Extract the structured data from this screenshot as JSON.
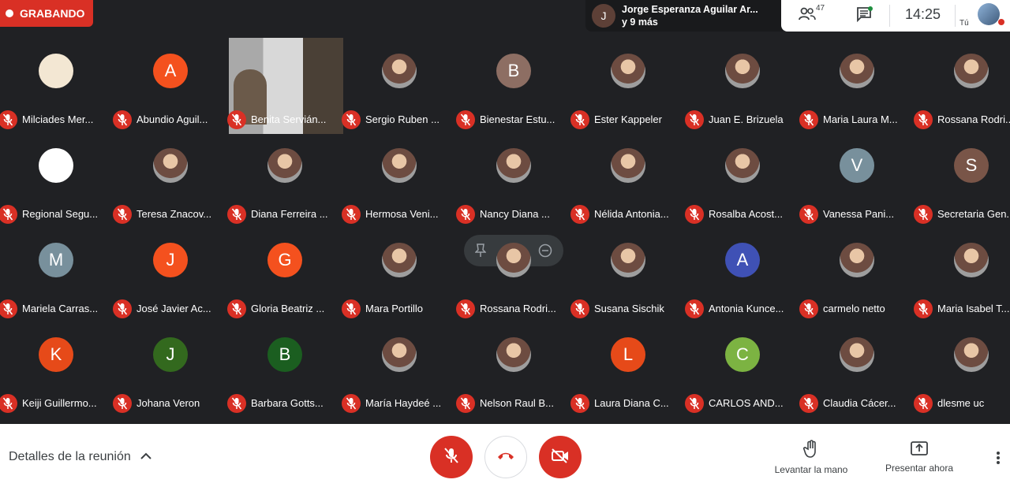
{
  "recording": {
    "label": "GRABANDO"
  },
  "active_speaker": {
    "initial": "J",
    "name": "Jorge Esperanza Aguilar Ar...",
    "more": "y 9 más"
  },
  "meeting_info": {
    "participant_count": "47",
    "time": "14:25",
    "self_label": "Tú"
  },
  "participants": [
    {
      "name": "Milciades Mer...",
      "initial": "",
      "color": "#f3e7d3"
    },
    {
      "name": "Abundio Aguil...",
      "initial": "A",
      "color": "#f4511e"
    },
    {
      "name": "Benita Servián...",
      "initial": "",
      "color": "",
      "video": true
    },
    {
      "name": "Sergio Ruben ...",
      "initial": "",
      "color": ""
    },
    {
      "name": "Bienestar Estu...",
      "initial": "B",
      "color": "#8d6e63"
    },
    {
      "name": "Ester Kappeler",
      "initial": "",
      "color": ""
    },
    {
      "name": "Juan E. Brizuela",
      "initial": "",
      "color": ""
    },
    {
      "name": "Maria Laura M...",
      "initial": "",
      "color": ""
    },
    {
      "name": "Rossana Rodri...",
      "initial": "",
      "color": ""
    },
    {
      "name": "Regional Segu...",
      "initial": "",
      "color": "#ffffff"
    },
    {
      "name": "Teresa Znacov...",
      "initial": "",
      "color": ""
    },
    {
      "name": "Diana Ferreira ...",
      "initial": "",
      "color": ""
    },
    {
      "name": "Hermosa Veni...",
      "initial": "",
      "color": ""
    },
    {
      "name": "Nancy Diana ...",
      "initial": "",
      "color": ""
    },
    {
      "name": "Nélida Antonia...",
      "initial": "",
      "color": ""
    },
    {
      "name": "Rosalba Acost...",
      "initial": "",
      "color": ""
    },
    {
      "name": "Vanessa Pani...",
      "initial": "V",
      "color": "#78909c"
    },
    {
      "name": "Secretaria Gen...",
      "initial": "S",
      "color": "#795548"
    },
    {
      "name": "Mariela Carras...",
      "initial": "M",
      "color": "#78909c"
    },
    {
      "name": "José Javier Ac...",
      "initial": "J",
      "color": "#f4511e"
    },
    {
      "name": "Gloria Beatriz ...",
      "initial": "G",
      "color": "#f4511e"
    },
    {
      "name": "Mara Portillo",
      "initial": "",
      "color": ""
    },
    {
      "name": "Rossana Rodri...",
      "initial": "",
      "color": "",
      "hover": true
    },
    {
      "name": "Susana Sischik",
      "initial": "",
      "color": ""
    },
    {
      "name": "Antonia Kunce...",
      "initial": "A",
      "color": "#3f51b5"
    },
    {
      "name": "carmelo netto",
      "initial": "",
      "color": ""
    },
    {
      "name": "Maria Isabel T...",
      "initial": "",
      "color": ""
    },
    {
      "name": "Keiji Guillermo...",
      "initial": "K",
      "color": "#e64a19"
    },
    {
      "name": "Johana Veron",
      "initial": "J",
      "color": "#33691e"
    },
    {
      "name": "Barbara Gotts...",
      "initial": "B",
      "color": "#1b5e20"
    },
    {
      "name": "María Haydeé ...",
      "initial": "",
      "color": ""
    },
    {
      "name": "Nelson Raul B...",
      "initial": "",
      "color": ""
    },
    {
      "name": "Laura Diana C...",
      "initial": "L",
      "color": "#e64a19"
    },
    {
      "name": "CARLOS AND...",
      "initial": "C",
      "color": "#7cb342"
    },
    {
      "name": "Claudia Cácer...",
      "initial": "",
      "color": ""
    },
    {
      "name": "dlesme uc",
      "initial": "",
      "color": ""
    }
  ],
  "bottom": {
    "details_label": "Detalles de la reunión",
    "raise_hand_label": "Levantar la mano",
    "present_label": "Presentar ahora"
  }
}
